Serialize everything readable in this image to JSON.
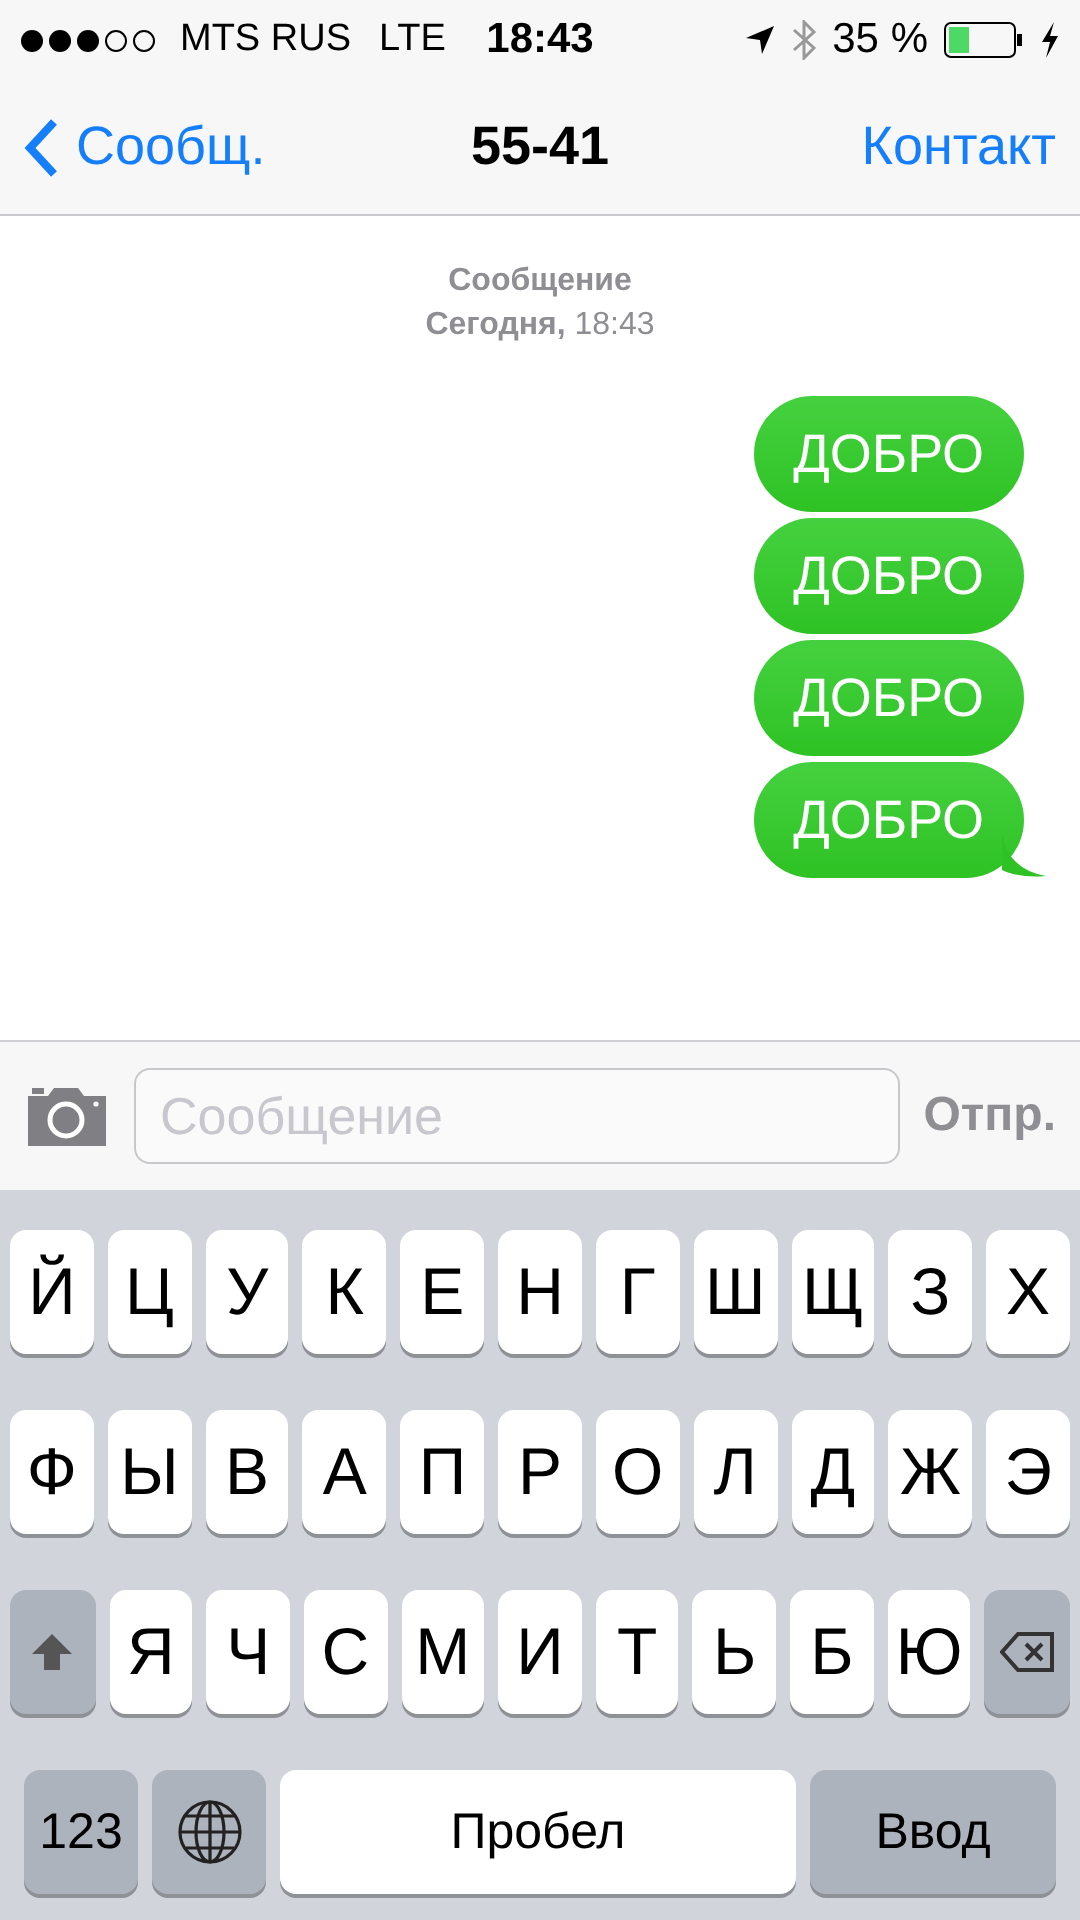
{
  "status_bar": {
    "carrier": "MTS RUS",
    "network": "LTE",
    "time": "18:43",
    "battery": "35 %"
  },
  "nav": {
    "back": "Сообщ.",
    "title": "55-41",
    "action": "Контакт"
  },
  "thread": {
    "service": "Сообщение",
    "date": "**Сегодня,** 18:43"
  },
  "messages": [
    {
      "text": "ДОБРО",
      "tail": false
    },
    {
      "text": "ДОБРО",
      "tail": false
    },
    {
      "text": "ДОБРО",
      "tail": false
    },
    {
      "text": "ДОБРО",
      "tail": true
    }
  ],
  "composer": {
    "placeholder": "Сообщение",
    "send": "Отпр."
  },
  "keyboard": [
    [
      {
        "kind": "letter",
        "label": "Й"
      },
      {
        "kind": "letter",
        "label": "Ц"
      },
      {
        "kind": "letter",
        "label": "У"
      },
      {
        "kind": "letter",
        "label": "К"
      },
      {
        "kind": "letter",
        "label": "Е"
      },
      {
        "kind": "letter",
        "label": "Н"
      },
      {
        "kind": "letter",
        "label": "Г"
      },
      {
        "kind": "letter",
        "label": "Ш"
      },
      {
        "kind": "letter",
        "label": "Щ"
      },
      {
        "kind": "letter",
        "label": "З"
      },
      {
        "kind": "letter",
        "label": "Х"
      }
    ],
    [
      {
        "kind": "letter",
        "label": "Ф"
      },
      {
        "kind": "letter",
        "label": "Ы"
      },
      {
        "kind": "letter",
        "label": "В"
      },
      {
        "kind": "letter",
        "label": "А"
      },
      {
        "kind": "letter",
        "label": "П"
      },
      {
        "kind": "letter",
        "label": "Р"
      },
      {
        "kind": "letter",
        "label": "О"
      },
      {
        "kind": "letter",
        "label": "Л"
      },
      {
        "kind": "letter",
        "label": "Д"
      },
      {
        "kind": "letter",
        "label": "Ж"
      },
      {
        "kind": "letter",
        "label": "Э"
      }
    ],
    [
      {
        "kind": "shift"
      },
      {
        "kind": "letter",
        "label": "Я"
      },
      {
        "kind": "letter",
        "label": "Ч"
      },
      {
        "kind": "letter",
        "label": "С"
      },
      {
        "kind": "letter",
        "label": "М"
      },
      {
        "kind": "letter",
        "label": "И"
      },
      {
        "kind": "letter",
        "label": "Т"
      },
      {
        "kind": "letter",
        "label": "Ь"
      },
      {
        "kind": "letter",
        "label": "Б"
      },
      {
        "kind": "letter",
        "label": "Ю"
      },
      {
        "kind": "backspace"
      }
    ],
    [
      {
        "kind": "numbers",
        "label": "123"
      },
      {
        "kind": "globe"
      },
      {
        "kind": "space",
        "label": "Пробел"
      },
      {
        "kind": "return",
        "label": "Ввод"
      }
    ]
  ]
}
